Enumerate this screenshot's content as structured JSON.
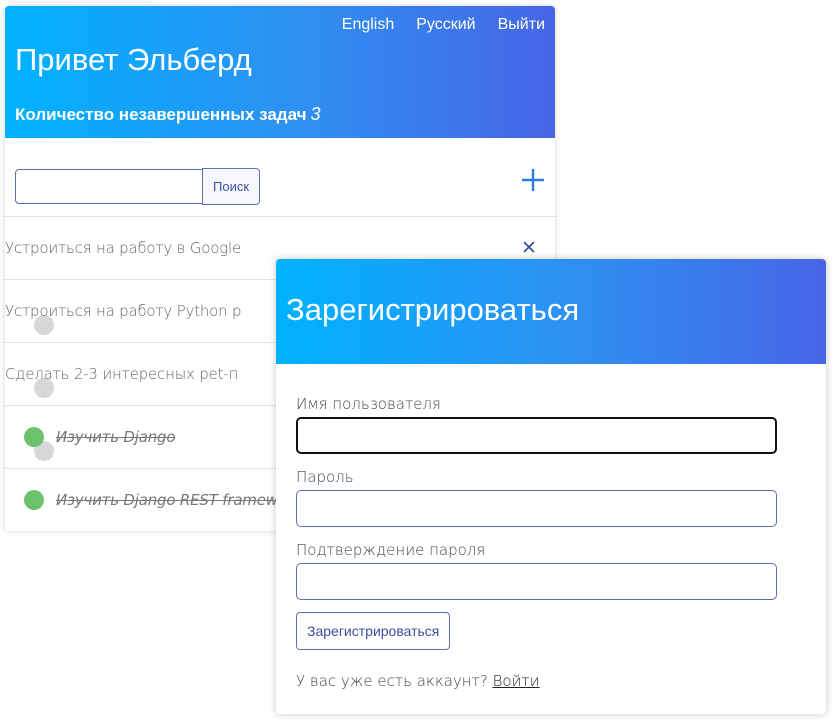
{
  "todo": {
    "nav": {
      "english": "English",
      "russian": "Русский",
      "logout": "Выйти"
    },
    "greeting": "Привет Эльберд",
    "pending_label": "Количество незавершенных задач",
    "pending_count": "3",
    "search": {
      "placeholder": "",
      "button": "Поиск"
    },
    "tasks": [
      {
        "text": "Устроиться на работу в Google",
        "done": false
      },
      {
        "text": "Устроиться на работу Python р",
        "done": false
      },
      {
        "text": "Сделать 2-3 интересных pet-п",
        "done": false
      },
      {
        "text": "Изучить Django",
        "done": true
      },
      {
        "text": "Изучить Django REST framewo",
        "done": true
      }
    ]
  },
  "register": {
    "title": "Зарегистрироваться",
    "username_label": "Имя пользователя",
    "password_label": "Пароль",
    "confirm_label": "Подтверждение пароля",
    "submit": "Зарегистрироваться",
    "have_account": "У вас уже есть аккаунт?",
    "login_link": "Войти"
  },
  "colors": {
    "gradient_start": "#00b2ff",
    "gradient_end": "#4765e6",
    "done_dot": "#6cc26c",
    "pending_dot": "#d7d7d7",
    "accent": "#3a4f9e"
  },
  "icons": {
    "add": "plus-icon",
    "delete": "close-icon"
  }
}
